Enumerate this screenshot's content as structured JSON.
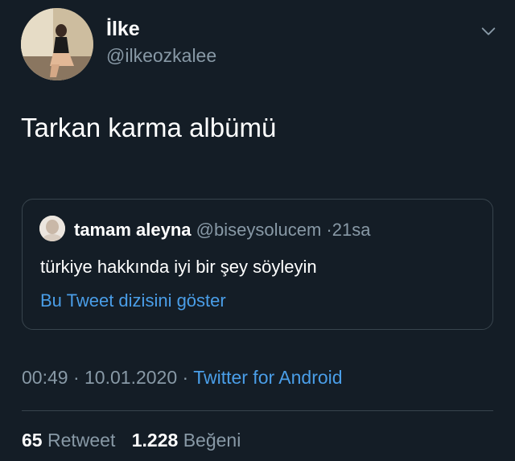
{
  "author": {
    "name": "İlke",
    "handle": "@ilkeozkalee"
  },
  "tweet": {
    "text": "Tarkan karma albümü"
  },
  "quoted": {
    "name": "tamam aleyna",
    "handle": "@biseysolucem",
    "separator": "·",
    "age": "21sa",
    "text": "türkiye hakkında iyi bir şey söyleyin",
    "thread_link": "Bu Tweet dizisini göster"
  },
  "meta": {
    "time": "00:49",
    "separator": "·",
    "date": "10.01.2020",
    "client": "Twitter for Android"
  },
  "stats": {
    "retweets_count": "65",
    "retweets_label": "Retweet",
    "likes_count": "1.228",
    "likes_label": "Beğeni"
  },
  "icons": {
    "more_menu": "chevron-down-icon"
  },
  "colors": {
    "background": "#141d26",
    "secondary_text": "#8899a6",
    "link": "#4a9ee8",
    "border": "#38444d"
  }
}
